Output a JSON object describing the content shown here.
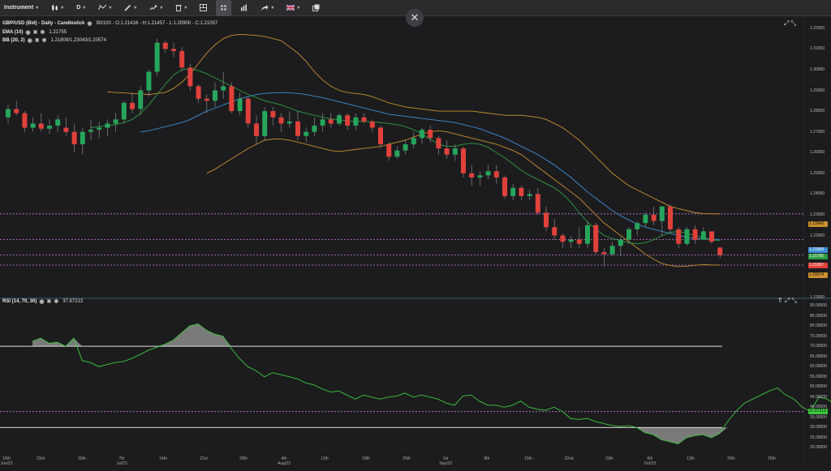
{
  "toolbar": {
    "instrument_label": "Instrument",
    "timeframe_label": "D"
  },
  "main_panel": {
    "title": "GBP/USD (Bid) - Daily - Candlestick",
    "ohlc": "90/100 - O:1.21416 - H:1.21457 - L:1.20900 - C:1.21057",
    "ema_name": "EMA (10)",
    "ema_value": "1.21755",
    "bb_name": "BB (20, 2)",
    "bb_value": "1.21809/1.23043/1.20574",
    "price_axis": [
      "1.32000",
      "1.31000",
      "1.30000",
      "1.29000",
      "1.28000",
      "1.27000",
      "1.26000",
      "1.25000",
      "1.24000",
      "1.23000",
      "1.22000",
      "1.21000",
      "1.20000",
      "1.19000"
    ],
    "tags": {
      "bb_upper": "1.23043",
      "bb_mid": "1.21809",
      "ema": "1.21755",
      "close": "1.21057",
      "bb_lower": "1.20574"
    }
  },
  "rsi_panel": {
    "name": "RSI (14, 70, 30)",
    "value": "37.87213",
    "axis": [
      "90.00000",
      "85.00000",
      "80.00000",
      "75.00000",
      "70.00000",
      "65.00000",
      "60.00000",
      "55.00000",
      "50.00000",
      "45.00000",
      "40.00000",
      "35.00000",
      "30.00000",
      "25.00000",
      "20.00000"
    ],
    "tag": "37.87213"
  },
  "x_axis": [
    {
      "label": "16th",
      "sub": "Jun/23"
    },
    {
      "label": "23rd",
      "sub": ""
    },
    {
      "label": "30th",
      "sub": ""
    },
    {
      "label": "7th",
      "sub": "Jul/23"
    },
    {
      "label": "14th",
      "sub": ""
    },
    {
      "label": "21st",
      "sub": ""
    },
    {
      "label": "28th",
      "sub": ""
    },
    {
      "label": "4th",
      "sub": "Aug/23"
    },
    {
      "label": "11th",
      "sub": ""
    },
    {
      "label": "18th",
      "sub": ""
    },
    {
      "label": "25th",
      "sub": ""
    },
    {
      "label": "1st",
      "sub": "Sep/23"
    },
    {
      "label": "8th",
      "sub": ""
    },
    {
      "label": "15th",
      "sub": ""
    },
    {
      "label": "22nd",
      "sub": ""
    },
    {
      "label": "29th",
      "sub": ""
    },
    {
      "label": "6th",
      "sub": "Oct/23"
    },
    {
      "label": "13th",
      "sub": ""
    },
    {
      "label": "20th",
      "sub": ""
    },
    {
      "label": "25th",
      "sub": ""
    }
  ],
  "colors": {
    "up": "#26a65b",
    "down": "#e0413a",
    "ema": "#2f9e44",
    "bb_mid": "#3d8fd6",
    "bb_band": "#c8902e",
    "rsi": "#3cc83c",
    "level": "#c87adb"
  },
  "chart_data": {
    "type": "candlestick",
    "candles": [
      {
        "o": 1.277,
        "h": 1.283,
        "l": 1.274,
        "c": 1.281
      },
      {
        "o": 1.281,
        "h": 1.285,
        "l": 1.278,
        "c": 1.279
      },
      {
        "o": 1.279,
        "h": 1.28,
        "l": 1.27,
        "c": 1.272
      },
      {
        "o": 1.272,
        "h": 1.277,
        "l": 1.27,
        "c": 1.274
      },
      {
        "o": 1.274,
        "h": 1.279,
        "l": 1.27,
        "c": 1.2715
      },
      {
        "o": 1.2715,
        "h": 1.276,
        "l": 1.269,
        "c": 1.273
      },
      {
        "o": 1.273,
        "h": 1.278,
        "l": 1.27,
        "c": 1.276
      },
      {
        "o": 1.272,
        "h": 1.277,
        "l": 1.268,
        "c": 1.27
      },
      {
        "o": 1.27,
        "h": 1.274,
        "l": 1.26,
        "c": 1.264
      },
      {
        "o": 1.264,
        "h": 1.272,
        "l": 1.259,
        "c": 1.27
      },
      {
        "o": 1.27,
        "h": 1.276,
        "l": 1.266,
        "c": 1.271
      },
      {
        "o": 1.271,
        "h": 1.275,
        "l": 1.267,
        "c": 1.272
      },
      {
        "o": 1.272,
        "h": 1.276,
        "l": 1.268,
        "c": 1.274
      },
      {
        "o": 1.274,
        "h": 1.279,
        "l": 1.27,
        "c": 1.276
      },
      {
        "o": 1.276,
        "h": 1.285,
        "l": 1.274,
        "c": 1.284
      },
      {
        "o": 1.284,
        "h": 1.289,
        "l": 1.279,
        "c": 1.281
      },
      {
        "o": 1.281,
        "h": 1.292,
        "l": 1.278,
        "c": 1.29
      },
      {
        "o": 1.29,
        "h": 1.3,
        "l": 1.287,
        "c": 1.299
      },
      {
        "o": 1.299,
        "h": 1.315,
        "l": 1.297,
        "c": 1.313
      },
      {
        "o": 1.313,
        "h": 1.314,
        "l": 1.308,
        "c": 1.31
      },
      {
        "o": 1.31,
        "h": 1.313,
        "l": 1.306,
        "c": 1.309
      },
      {
        "o": 1.309,
        "h": 1.311,
        "l": 1.299,
        "c": 1.301
      },
      {
        "o": 1.301,
        "h": 1.303,
        "l": 1.29,
        "c": 1.292
      },
      {
        "o": 1.292,
        "h": 1.293,
        "l": 1.284,
        "c": 1.286
      },
      {
        "o": 1.286,
        "h": 1.288,
        "l": 1.279,
        "c": 1.285
      },
      {
        "o": 1.285,
        "h": 1.294,
        "l": 1.282,
        "c": 1.29
      },
      {
        "o": 1.29,
        "h": 1.299,
        "l": 1.286,
        "c": 1.292
      },
      {
        "o": 1.292,
        "h": 1.294,
        "l": 1.279,
        "c": 1.28
      },
      {
        "o": 1.28,
        "h": 1.289,
        "l": 1.278,
        "c": 1.286
      },
      {
        "o": 1.286,
        "h": 1.287,
        "l": 1.272,
        "c": 1.274
      },
      {
        "o": 1.274,
        "h": 1.278,
        "l": 1.264,
        "c": 1.268
      },
      {
        "o": 1.268,
        "h": 1.282,
        "l": 1.266,
        "c": 1.28
      },
      {
        "o": 1.28,
        "h": 1.282,
        "l": 1.273,
        "c": 1.277
      },
      {
        "o": 1.277,
        "h": 1.279,
        "l": 1.27,
        "c": 1.274
      },
      {
        "o": 1.274,
        "h": 1.28,
        "l": 1.272,
        "c": 1.275
      },
      {
        "o": 1.275,
        "h": 1.28,
        "l": 1.266,
        "c": 1.268
      },
      {
        "o": 1.268,
        "h": 1.272,
        "l": 1.265,
        "c": 1.27
      },
      {
        "o": 1.27,
        "h": 1.277,
        "l": 1.268,
        "c": 1.273
      },
      {
        "o": 1.273,
        "h": 1.279,
        "l": 1.27,
        "c": 1.276
      },
      {
        "o": 1.276,
        "h": 1.279,
        "l": 1.272,
        "c": 1.274
      },
      {
        "o": 1.274,
        "h": 1.279,
        "l": 1.273,
        "c": 1.278
      },
      {
        "o": 1.278,
        "h": 1.279,
        "l": 1.271,
        "c": 1.273
      },
      {
        "o": 1.273,
        "h": 1.279,
        "l": 1.271,
        "c": 1.277
      },
      {
        "o": 1.277,
        "h": 1.279,
        "l": 1.274,
        "c": 1.275
      },
      {
        "o": 1.275,
        "h": 1.276,
        "l": 1.27,
        "c": 1.272
      },
      {
        "o": 1.272,
        "h": 1.273,
        "l": 1.262,
        "c": 1.264
      },
      {
        "o": 1.264,
        "h": 1.265,
        "l": 1.256,
        "c": 1.258
      },
      {
        "o": 1.258,
        "h": 1.263,
        "l": 1.257,
        "c": 1.261
      },
      {
        "o": 1.261,
        "h": 1.266,
        "l": 1.259,
        "c": 1.264
      },
      {
        "o": 1.264,
        "h": 1.27,
        "l": 1.262,
        "c": 1.267
      },
      {
        "o": 1.267,
        "h": 1.272,
        "l": 1.264,
        "c": 1.271
      },
      {
        "o": 1.271,
        "h": 1.273,
        "l": 1.265,
        "c": 1.267
      },
      {
        "o": 1.267,
        "h": 1.268,
        "l": 1.259,
        "c": 1.262
      },
      {
        "o": 1.262,
        "h": 1.266,
        "l": 1.257,
        "c": 1.259
      },
      {
        "o": 1.259,
        "h": 1.264,
        "l": 1.256,
        "c": 1.262
      },
      {
        "o": 1.262,
        "h": 1.263,
        "l": 1.248,
        "c": 1.25
      },
      {
        "o": 1.25,
        "h": 1.254,
        "l": 1.244,
        "c": 1.248
      },
      {
        "o": 1.248,
        "h": 1.251,
        "l": 1.244,
        "c": 1.249
      },
      {
        "o": 1.249,
        "h": 1.254,
        "l": 1.247,
        "c": 1.251
      },
      {
        "o": 1.251,
        "h": 1.254,
        "l": 1.245,
        "c": 1.248
      },
      {
        "o": 1.248,
        "h": 1.249,
        "l": 1.238,
        "c": 1.239
      },
      {
        "o": 1.239,
        "h": 1.245,
        "l": 1.237,
        "c": 1.243
      },
      {
        "o": 1.243,
        "h": 1.244,
        "l": 1.237,
        "c": 1.239
      },
      {
        "o": 1.239,
        "h": 1.242,
        "l": 1.237,
        "c": 1.24
      },
      {
        "o": 1.24,
        "h": 1.243,
        "l": 1.23,
        "c": 1.231
      },
      {
        "o": 1.231,
        "h": 1.234,
        "l": 1.222,
        "c": 1.224
      },
      {
        "o": 1.224,
        "h": 1.228,
        "l": 1.218,
        "c": 1.22
      },
      {
        "o": 1.22,
        "h": 1.221,
        "l": 1.214,
        "c": 1.217
      },
      {
        "o": 1.217,
        "h": 1.22,
        "l": 1.214,
        "c": 1.218
      },
      {
        "o": 1.218,
        "h": 1.224,
        "l": 1.214,
        "c": 1.216
      },
      {
        "o": 1.216,
        "h": 1.227,
        "l": 1.214,
        "c": 1.225
      },
      {
        "o": 1.225,
        "h": 1.226,
        "l": 1.211,
        "c": 1.212
      },
      {
        "o": 1.212,
        "h": 1.214,
        "l": 1.205,
        "c": 1.211
      },
      {
        "o": 1.211,
        "h": 1.217,
        "l": 1.21,
        "c": 1.215
      },
      {
        "o": 1.215,
        "h": 1.219,
        "l": 1.21,
        "c": 1.218
      },
      {
        "o": 1.218,
        "h": 1.224,
        "l": 1.216,
        "c": 1.223
      },
      {
        "o": 1.223,
        "h": 1.227,
        "l": 1.22,
        "c": 1.226
      },
      {
        "o": 1.226,
        "h": 1.231,
        "l": 1.224,
        "c": 1.23
      },
      {
        "o": 1.23,
        "h": 1.234,
        "l": 1.225,
        "c": 1.227
      },
      {
        "o": 1.227,
        "h": 1.234,
        "l": 1.22,
        "c": 1.234
      },
      {
        "o": 1.234,
        "h": 1.235,
        "l": 1.221,
        "c": 1.223
      },
      {
        "o": 1.223,
        "h": 1.224,
        "l": 1.214,
        "c": 1.216
      },
      {
        "o": 1.216,
        "h": 1.224,
        "l": 1.215,
        "c": 1.223
      },
      {
        "o": 1.223,
        "h": 1.225,
        "l": 1.216,
        "c": 1.218
      },
      {
        "o": 1.218,
        "h": 1.224,
        "l": 1.218,
        "c": 1.222
      },
      {
        "o": 1.222,
        "h": 1.222,
        "l": 1.216,
        "c": 1.217
      },
      {
        "o": 1.21416,
        "h": 1.21457,
        "l": 1.209,
        "c": 1.21057
      }
    ],
    "rsi": [
      72.5,
      74,
      71.5,
      72,
      70,
      74,
      63,
      62,
      60,
      61,
      62,
      62.5,
      64,
      66,
      68,
      69.5,
      71,
      73,
      76.5,
      80,
      81,
      78,
      76,
      75,
      69,
      64,
      60,
      58,
      55,
      57,
      56,
      55,
      54,
      52,
      51,
      49,
      47.5,
      48,
      46,
      44,
      46,
      45,
      44,
      45,
      45.5,
      47,
      45,
      46,
      45,
      44,
      42,
      41,
      45.5,
      46,
      43,
      41,
      41,
      40,
      41,
      43,
      40,
      39,
      38.5,
      40,
      38,
      34.5,
      34,
      34.5,
      33,
      32,
      31,
      30.5,
      31,
      30,
      27.5,
      26.5,
      24,
      23,
      22,
      25,
      26,
      26.5,
      25,
      27,
      33,
      38,
      42,
      44,
      46,
      48,
      49.5,
      46,
      44,
      40,
      38,
      45,
      44,
      41,
      38.5,
      37.87
    ],
    "bb_upper": [
      1.2893,
      1.289,
      1.2888,
      1.2885,
      1.2883,
      1.288,
      1.2885,
      1.289,
      1.291,
      1.294,
      1.298,
      1.303,
      1.308,
      1.312,
      1.315,
      1.3165,
      1.317,
      1.3168,
      1.3165,
      1.316,
      1.315,
      1.314,
      1.311,
      1.308,
      1.304,
      1.299,
      1.295,
      1.292,
      1.29,
      1.289,
      1.2885,
      1.288,
      1.287,
      1.2855,
      1.284,
      1.283,
      1.282,
      1.2815,
      1.281,
      1.2805,
      1.28,
      1.28,
      1.28,
      1.28,
      1.28,
      1.2795,
      1.279,
      1.2785,
      1.278,
      1.278,
      1.278,
      1.2775,
      1.277,
      1.276,
      1.274,
      1.272,
      1.269,
      1.266,
      1.262,
      1.258,
      1.254,
      1.25,
      1.247,
      1.244,
      1.242,
      1.24,
      1.238,
      1.236,
      1.234,
      1.233,
      1.232,
      1.231,
      1.2306,
      1.2305,
      1.2304
    ],
    "bb_mid": [
      1.27,
      1.2705,
      1.2715,
      1.2725,
      1.2735,
      1.2745,
      1.276,
      1.278,
      1.28,
      1.2815,
      1.283,
      1.2845,
      1.286,
      1.287,
      1.288,
      1.2885,
      1.2888,
      1.289,
      1.2888,
      1.2885,
      1.288,
      1.2872,
      1.2865,
      1.2855,
      1.2845,
      1.2835,
      1.2825,
      1.2815,
      1.2805,
      1.2795,
      1.2785,
      1.278,
      1.2775,
      1.277,
      1.2765,
      1.276,
      1.2755,
      1.275,
      1.2745,
      1.2735,
      1.2725,
      1.2715,
      1.27,
      1.2685,
      1.267,
      1.265,
      1.263,
      1.261,
      1.259,
      1.2565,
      1.254,
      1.251,
      1.248,
      1.2445,
      1.241,
      1.238,
      1.235,
      1.232,
      1.2295,
      1.2275,
      1.2255,
      1.224,
      1.223,
      1.222,
      1.221,
      1.22,
      1.2192,
      1.2186,
      1.2183,
      1.2181,
      1.2181
    ],
    "bb_lower": [
      1.25,
      1.252,
      1.2545,
      1.257,
      1.2595,
      1.262,
      1.264,
      1.266,
      1.2665,
      1.2665,
      1.266,
      1.265,
      1.264,
      1.263,
      1.262,
      1.261,
      1.2605,
      1.261,
      1.2615,
      1.262,
      1.2625,
      1.263,
      1.264,
      1.265,
      1.266,
      1.2675,
      1.269,
      1.27,
      1.2705,
      1.27,
      1.269,
      1.268,
      1.267,
      1.266,
      1.265,
      1.264,
      1.2625,
      1.261,
      1.259,
      1.256,
      1.253,
      1.25,
      1.247,
      1.244,
      1.241,
      1.238,
      1.234,
      1.23,
      1.226,
      1.223,
      1.22,
      1.217,
      1.214,
      1.211,
      1.2085,
      1.2065,
      1.2055,
      1.205,
      1.2052,
      1.2056,
      1.206,
      1.2058,
      1.2057
    ],
    "ema": [
      1.272,
      1.2725,
      1.273,
      1.2735,
      1.2745,
      1.276,
      1.279,
      1.283,
      1.288,
      1.293,
      1.2975,
      1.3,
      1.3005,
      1.2995,
      1.298,
      1.296,
      1.294,
      1.292,
      1.29,
      1.288,
      1.2865,
      1.285,
      1.284,
      1.283,
      1.2815,
      1.28,
      1.279,
      1.278,
      1.277,
      1.2763,
      1.2758,
      1.2752,
      1.275,
      1.275,
      1.2748,
      1.2745,
      1.274,
      1.2735,
      1.2725,
      1.271,
      1.269,
      1.2665,
      1.264,
      1.263,
      1.263,
      1.264,
      1.2645,
      1.264,
      1.2625,
      1.26,
      1.2575,
      1.2545,
      1.2515,
      1.249,
      1.247,
      1.245,
      1.243,
      1.24,
      1.236,
      1.231,
      1.2265,
      1.223,
      1.22,
      1.2185,
      1.2175,
      1.2165,
      1.216,
      1.2165,
      1.218,
      1.22,
      1.2215,
      1.222,
      1.221,
      1.22,
      1.219,
      1.218,
      1.2175
    ],
    "price_range": [
      1.185,
      1.325
    ],
    "rsi_range": [
      17,
      92
    ],
    "rsi_levels": [
      70,
      30
    ],
    "h_levels": [
      1.23043,
      1.21809,
      1.21057,
      1.20574
    ]
  }
}
